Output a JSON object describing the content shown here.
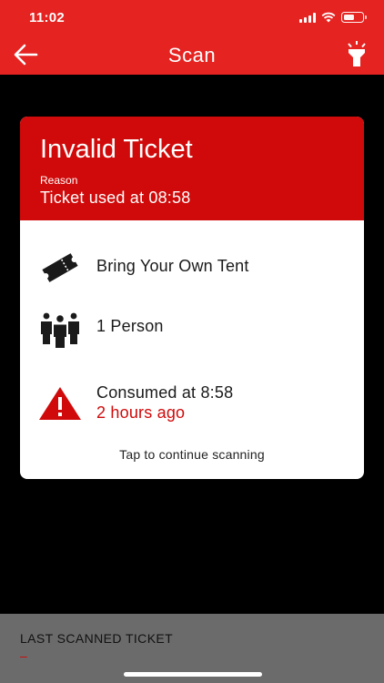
{
  "status_bar": {
    "time": "11:02"
  },
  "app_bar": {
    "title": "Scan"
  },
  "result": {
    "title": "Invalid Ticket",
    "reason_label": "Reason",
    "reason_value": "Ticket used at 08:58",
    "ticket_type": "Bring Your Own Tent",
    "persons": "1 Person",
    "consumed": "Consumed at 8:58",
    "consumed_ago": "2 hours ago",
    "tap_hint": "Tap to continue scanning"
  },
  "last_scanned": {
    "label": "LAST SCANNED TICKET",
    "value": "–"
  },
  "colors": {
    "app_bar": "#e52321",
    "card_header": "#d00a0a",
    "accent_text": "#d00a0a",
    "bottom_bar": "#6b6b6b"
  }
}
